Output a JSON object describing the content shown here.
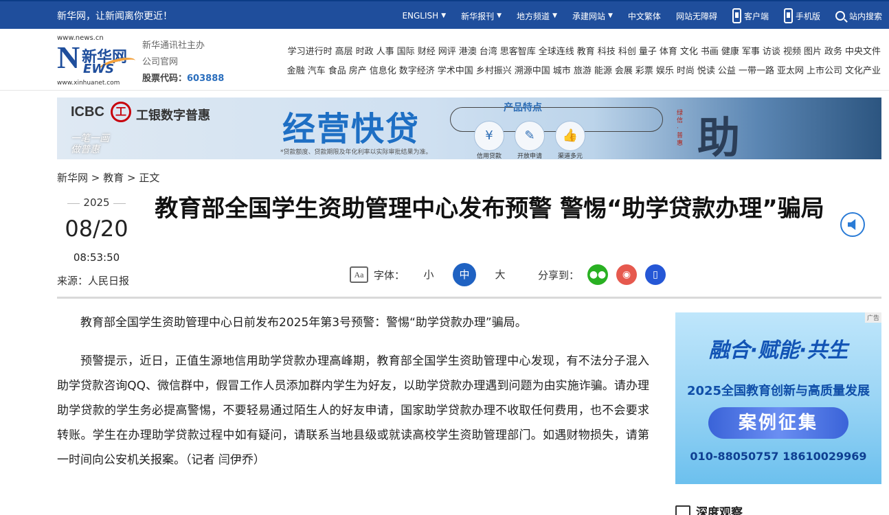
{
  "topbar": {
    "slogan": "新华网，让新闻离你更近！",
    "items": [
      {
        "label": "ENGLISH",
        "caret": true
      },
      {
        "label": "新华报刊",
        "caret": true
      },
      {
        "label": "地方频道",
        "caret": true
      },
      {
        "label": "承建网站",
        "caret": true
      },
      {
        "label": "中文繁体",
        "caret": false
      },
      {
        "label": "网站无障碍",
        "caret": false
      }
    ],
    "client_label": "客户端",
    "mobile_label": "手机版",
    "search_label": "站内搜索"
  },
  "logo": {
    "url_top": "www.news.cn",
    "letter_n": "N",
    "name_cn": "新华网",
    "letters_ews": "EWS",
    "url_bottom": "www.xinhuanet.com"
  },
  "org": {
    "line1": "新华通讯社主办",
    "line2": "公司官网",
    "stock_label": "股票代码：",
    "stock_code": "603888"
  },
  "channels": {
    "row1": [
      "学习进行时",
      "高层",
      "时政",
      "人事",
      "国际",
      "财经",
      "网评",
      "港澳",
      "台湾",
      "思客智库",
      "全球连线",
      "教育",
      "科技",
      "科创",
      "量子",
      "体育",
      "文化",
      "书画",
      "健康",
      "军事",
      "访谈",
      "视频",
      "图片",
      "政务",
      "中央文件"
    ],
    "row2": [
      "金融",
      "汽车",
      "食品",
      "房产",
      "信息化",
      "数字经济",
      "学术中国",
      "乡村振兴",
      "溯源中国",
      "城市",
      "旅游",
      "能源",
      "会展",
      "彩票",
      "娱乐",
      "时尚",
      "悦读",
      "公益",
      "一带一路",
      "亚太网",
      "上市公司",
      "文化产业"
    ]
  },
  "banner": {
    "brand": "ICBC",
    "brand_mark": "工",
    "brand_cn": "工银数字普惠",
    "slogan": "一笔一画 做普惠",
    "headline": "经营快贷",
    "features_title": "产品特点",
    "features": [
      "信用贷款",
      "开放申请",
      "渠道多元"
    ],
    "note": "*贷款额度、贷款期限及年化利率以实际审批结果为准。",
    "seal_text": "绿信 · 普惠",
    "big_char": "助"
  },
  "breadcrumb": {
    "items": [
      "新华网",
      "教育",
      "正文"
    ],
    "separator": ">"
  },
  "article": {
    "year": "2025",
    "month_day": "08/20",
    "time": "08:53:50",
    "source": "来源：人民日报",
    "title": "教育部全国学生资助管理中心发布预警 警惕“助学贷款办理”骗局",
    "font_label": "字体：",
    "font_icon_text": "Aa",
    "font_sizes": [
      "小",
      "中",
      "大"
    ],
    "font_size_selected": "中",
    "share_label": "分享到：",
    "paragraphs": [
      "教育部全国学生资助管理中心日前发布2025年第3号预警：警惕“助学贷款办理”骗局。",
      "预警提示，近日，正值生源地信用助学贷款办理高峰期，教育部全国学生资助管理中心发现，有不法分子混入助学贷款咨询QQ、微信群中，假冒工作人员添加群内学生为好友，以助学贷款办理遇到问题为由实施诈骗。请办理助学贷款的学生务必提高警惕，不要轻易通过陌生人的好友申请，国家助学贷款办理不收取任何费用，也不会要求转账。学生在办理助学贷款过程中如有疑问，请联系当地县级或就读高校学生资助管理部门。如遇财物损失，请第一时间向公安机关报案。（记者 闫伊乔）"
    ]
  },
  "side_ad": {
    "tag": "广告",
    "title": "融合·赋能·共生",
    "subtitle": "2025全国教育创新与高质量发展",
    "button": "案例征集",
    "phones": "010-88050757  18610029969"
  },
  "sidebar": {
    "deep_title": "深度观察"
  },
  "colors": {
    "topbar": "#1f4e9c",
    "accent": "#1f62c2",
    "wechat": "#29b022",
    "weibo": "#e6594e"
  }
}
